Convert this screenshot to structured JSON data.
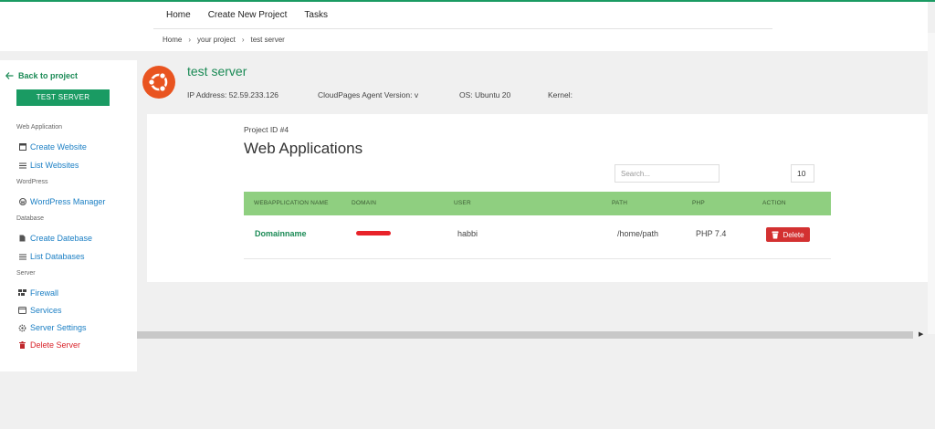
{
  "nav": {
    "items": [
      "Home",
      "Create New Project",
      "Tasks"
    ]
  },
  "breadcrumb": {
    "items": [
      "Home",
      "your project",
      "test server"
    ],
    "separator": "›"
  },
  "sidebar": {
    "back_label": "Back to project",
    "server_button": "TEST SERVER",
    "sections": {
      "web_application": "Web Application",
      "wordpress": "WordPress",
      "database": "Database",
      "server": "Server"
    },
    "items": {
      "create_website": "Create Website",
      "list_websites": "List Websites",
      "wordpress_manager": "WordPress Manager",
      "create_database": "Create Datebase",
      "list_databases": "List Databases",
      "firewall": "Firewall",
      "services": "Services",
      "server_settings": "Server Settings",
      "delete_server": "Delete Server"
    }
  },
  "server": {
    "name": "test server",
    "ip": "IP Address: 52.59.233.126",
    "agent": "CloudPages Agent Version: v",
    "os": "OS: Ubuntu 20",
    "kernel": "Kernel:"
  },
  "panel": {
    "project_id": "Project ID #4",
    "title": "Web Applications",
    "search_placeholder": "Search...",
    "page_size": "10"
  },
  "table": {
    "headers": {
      "name": "WEBAPPLICATION NAME",
      "domain": "DOMAIN",
      "user": "USER",
      "path": "PATH",
      "php": "PHP",
      "action": "ACTION"
    },
    "rows": [
      {
        "name": "Domainname",
        "user": "habbi",
        "path": "/home/path",
        "php": "PHP 7.4",
        "action": "Delete"
      }
    ]
  },
  "colors": {
    "accent": "#1a9b63",
    "table_header": "#8fcf80",
    "danger": "#d33131",
    "link": "#1b7fc4",
    "ubuntu": "#e95420"
  }
}
